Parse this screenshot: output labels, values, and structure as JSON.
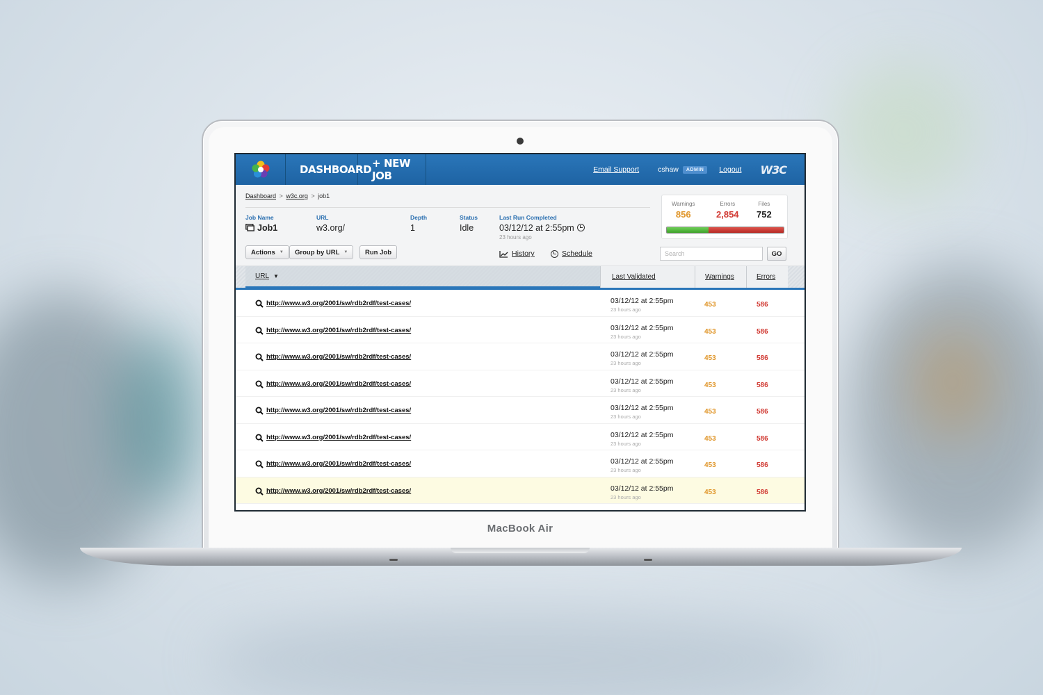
{
  "device": {
    "label": "MacBook Air"
  },
  "colors": {
    "accent": "#1e63a3",
    "warning": "#e0962a",
    "error": "#d13a33",
    "link_label": "#2a6fb0"
  },
  "nav": {
    "dashboard_label": "DASHBOARD",
    "new_job_label": "+ NEW JOB",
    "email_support": "Email Support",
    "user": "cshaw",
    "admin_badge": "ADMIN",
    "logout": "Logout",
    "w3c_logo": "W3C"
  },
  "breadcrumb": {
    "items": [
      "Dashboard",
      "w3c.org",
      "job1"
    ],
    "separator": ">"
  },
  "job": {
    "name_label": "Job Name",
    "name": "Job1",
    "url_label": "URL",
    "url": "w3.org/",
    "depth_label": "Depth",
    "depth": "1",
    "status_label": "Status",
    "status": "Idle",
    "last_run_label": "Last Run Completed",
    "last_run": "03/12/12 at 2:55pm",
    "last_run_ago": "23 hours ago"
  },
  "toolbar": {
    "actions": "Actions",
    "group_by": "Group by URL",
    "run_job": "Run Job",
    "history": "History",
    "schedule": "Schedule"
  },
  "stats": {
    "warnings_label": "Warnings",
    "warnings": "856",
    "errors_label": "Errors",
    "errors": "2,854",
    "files_label": "Files",
    "files": "752",
    "ratio_green": 0.36
  },
  "search": {
    "placeholder": "Search",
    "go": "GO"
  },
  "table": {
    "columns": {
      "url": "URL",
      "last_validated": "Last Validated",
      "warnings": "Warnings",
      "errors": "Errors"
    },
    "rows": [
      {
        "url": "http://www.w3.org/2001/sw/rdb2rdf/test-cases/",
        "date": "03/12/12 at 2:55pm",
        "ago": "23 hours ago",
        "warnings": "453",
        "errors": "586"
      },
      {
        "url": "http://www.w3.org/2001/sw/rdb2rdf/test-cases/",
        "date": "03/12/12 at 2:55pm",
        "ago": "23 hours ago",
        "warnings": "453",
        "errors": "586"
      },
      {
        "url": "http://www.w3.org/2001/sw/rdb2rdf/test-cases/",
        "date": "03/12/12 at 2:55pm",
        "ago": "23 hours ago",
        "warnings": "453",
        "errors": "586"
      },
      {
        "url": "http://www.w3.org/2001/sw/rdb2rdf/test-cases/",
        "date": "03/12/12 at 2:55pm",
        "ago": "23 hours ago",
        "warnings": "453",
        "errors": "586"
      },
      {
        "url": "http://www.w3.org/2001/sw/rdb2rdf/test-cases/",
        "date": "03/12/12 at 2:55pm",
        "ago": "23 hours ago",
        "warnings": "453",
        "errors": "586"
      },
      {
        "url": "http://www.w3.org/2001/sw/rdb2rdf/test-cases/",
        "date": "03/12/12 at 2:55pm",
        "ago": "23 hours ago",
        "warnings": "453",
        "errors": "586"
      },
      {
        "url": "http://www.w3.org/2001/sw/rdb2rdf/test-cases/",
        "date": "03/12/12 at 2:55pm",
        "ago": "23 hours ago",
        "warnings": "453",
        "errors": "586"
      },
      {
        "url": "http://www.w3.org/2001/sw/rdb2rdf/test-cases/",
        "date": "03/12/12 at 2:55pm",
        "ago": "23 hours ago",
        "warnings": "453",
        "errors": "586"
      }
    ]
  }
}
